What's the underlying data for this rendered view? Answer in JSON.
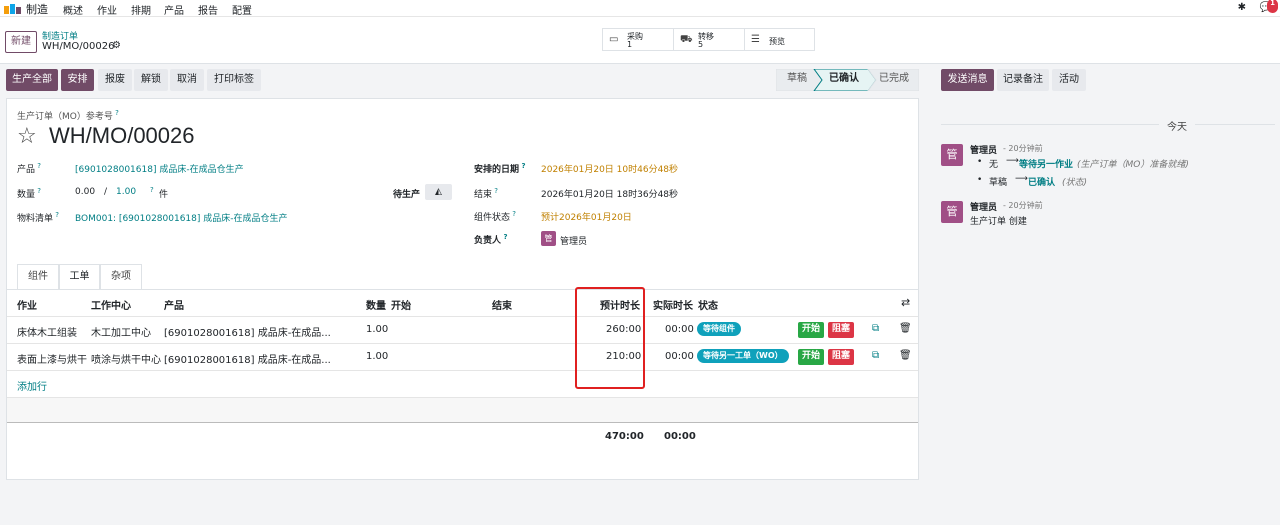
{
  "navbar": {
    "app": "制造",
    "menu": [
      "概述",
      "作业",
      "排期",
      "产品",
      "报告",
      "配置"
    ],
    "chat_count": "1"
  },
  "control": {
    "new_label": "新建",
    "breadcrumb_parent": "制造订单",
    "breadcrumb_current": "WH/MO/00026",
    "smart": [
      {
        "label": "采购",
        "value": "1",
        "icon": "credit-card-icon"
      },
      {
        "label": "转移",
        "value": "5",
        "icon": "truck-icon"
      },
      {
        "label": "预览",
        "value": "",
        "icon": "list-icon"
      }
    ]
  },
  "actions": {
    "primary": [
      "生产全部",
      "安排"
    ],
    "secondary": [
      "报废",
      "解锁",
      "取消",
      "打印标签"
    ]
  },
  "stages": {
    "draft": "草稿",
    "confirmed": "已确认",
    "done": "已完成"
  },
  "chatter_buttons": {
    "send": "发送消息",
    "log": "记录备注",
    "activity": "活动"
  },
  "form": {
    "ref_label": "生产订单（MO）参考号",
    "name": "WH/MO/00026",
    "product_label": "产品",
    "product_value": "[6901028001618] 成品床-在成品仓生产",
    "qty_label": "数量",
    "qty_done": "0.00",
    "qty_sep": "/",
    "qty_total": "1.00",
    "qty_uom": "件",
    "to_produce_label": "待生产",
    "bom_label": "物料清单",
    "bom_value": "BOM001: [6901028001618] 成品床-在成品仓生产",
    "sched_label": "安排的日期",
    "sched_value": "2026年01月20日 10时46分48秒",
    "end_label": "结束",
    "end_value": "2026年01月20日 18时36分48秒",
    "comp_label": "组件状态",
    "comp_value": "预计2026年01月20日",
    "resp_label": "负责人",
    "resp_avatar": "管",
    "resp_value": "管理员"
  },
  "tabs": [
    "组件",
    "工单",
    "杂项"
  ],
  "table": {
    "headers": {
      "op": "作业",
      "wc": "工作中心",
      "product": "产品",
      "qty": "数量",
      "start": "开始",
      "end": "结束",
      "expected": "预计时长",
      "real": "实际时长",
      "state": "状态"
    },
    "rows": [
      {
        "op": "床体木工组装",
        "wc": "木工加工中心",
        "product": "[6901028001618] 成品床-在成品...",
        "qty": "1.00",
        "expected": "260:00",
        "real": "00:00",
        "state": "等待组件",
        "start_btn": "开始",
        "block_btn": "阻塞"
      },
      {
        "op": "表面上漆与烘干",
        "wc": "喷涂与烘干中心",
        "product": "[6901028001618] 成品床-在成品...",
        "qty": "1.00",
        "expected": "210:00",
        "real": "00:00",
        "state": "等待另一工单（WO）",
        "start_btn": "开始",
        "block_btn": "阻塞"
      }
    ],
    "add_line": "添加行",
    "total_expected": "470:00",
    "total_real": "00:00"
  },
  "chatter": {
    "today": "今天",
    "messages": [
      {
        "avatar": "管",
        "author": "管理员",
        "time": "- 20分钟前",
        "changes": [
          {
            "from": "无",
            "to": "等待另一作业",
            "field": "(生产订单（MO）准备就绪)"
          },
          {
            "from": "草稿",
            "to": "已确认",
            "field": "(状态)"
          }
        ]
      },
      {
        "avatar": "管",
        "author": "管理员",
        "time": "- 20分钟前",
        "body": "生产订单 创建"
      }
    ]
  }
}
